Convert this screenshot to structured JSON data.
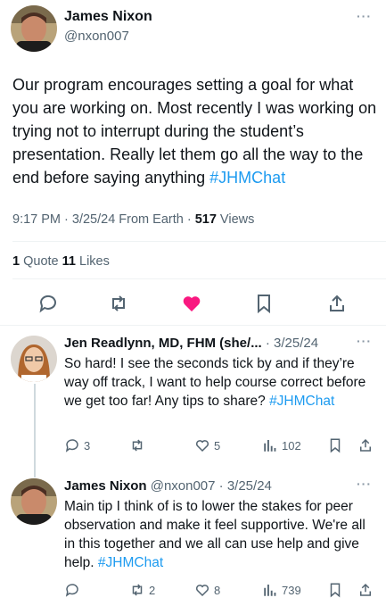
{
  "main_tweet": {
    "name": "James Nixon",
    "handle": "@nxon007",
    "text": "Our program encourages setting a goal for what you are working on. Most recently I was working on trying not to interrupt during the student’s presentation. Really let them go all the way to the end before saying anything ",
    "hashtag": "#JHMChat",
    "time": "9:17 PM · 3/25/24 From Earth · ",
    "views_count": "517",
    "views_label": " Views",
    "quotes_count": "1",
    "quotes_label": " Quote  ",
    "likes_count": "11",
    "likes_label": " Likes",
    "more": "···",
    "like_color": "#f91880"
  },
  "replies": [
    {
      "name": "Jen Readlynn, MD, FHM (she/...",
      "date": " · 3/25/24",
      "text": "So hard! I see the seconds tick by and if they’re way off track, I want to help course correct before we get too far! Any tips to share? ",
      "hashtag": "#JHMChat",
      "replies": "3",
      "retweets": "",
      "likes": "5",
      "views": "102",
      "more": "···"
    },
    {
      "name": "James Nixon",
      "handle": " @nxon007",
      "date": " · 3/25/24",
      "text": "Main tip I think of is to lower the stakes for peer observation and make it feel supportive. We're all in this together and we all can use help and give help. ",
      "hashtag": "#JHMChat",
      "replies": "",
      "retweets": "2",
      "likes": "8",
      "views": "739",
      "more": "···"
    }
  ],
  "colors": {
    "accent": "#1d9bf0",
    "muted": "#536471",
    "divider": "#eff3f4"
  }
}
